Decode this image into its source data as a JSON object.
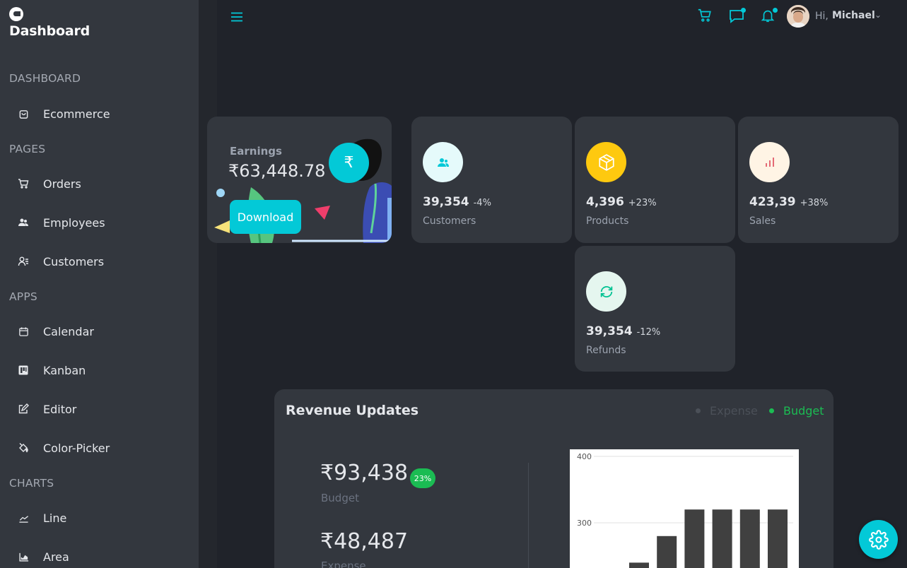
{
  "brand": {
    "title": "Dashboard"
  },
  "sidebar": {
    "sections": [
      {
        "title": "DASHBOARD",
        "items": [
          {
            "label": "Ecommerce",
            "icon": "shopping-bag-icon"
          }
        ]
      },
      {
        "title": "PAGES",
        "items": [
          {
            "label": "Orders",
            "icon": "cart-icon"
          },
          {
            "label": "Employees",
            "icon": "employees-icon"
          },
          {
            "label": "Customers",
            "icon": "customers-icon"
          }
        ]
      },
      {
        "title": "APPS",
        "items": [
          {
            "label": "Calendar",
            "icon": "calendar-icon"
          },
          {
            "label": "Kanban",
            "icon": "kanban-icon"
          },
          {
            "label": "Editor",
            "icon": "edit-icon"
          },
          {
            "label": "Color-Picker",
            "icon": "paint-bucket-icon"
          }
        ]
      },
      {
        "title": "CHARTS",
        "items": [
          {
            "label": "Line",
            "icon": "line-chart-icon"
          },
          {
            "label": "Area",
            "icon": "area-chart-icon"
          }
        ]
      }
    ]
  },
  "topbar": {
    "greeting": "Hi,",
    "user_name": "Michael",
    "chevron": "⌄"
  },
  "earnings": {
    "label": "Earnings",
    "value": "₹63,448.78",
    "currency_symbol": "₹",
    "download_label": "Download"
  },
  "stats": [
    {
      "value": "39,354",
      "percent": "-4%",
      "label": "Customers",
      "icon": "customers-icon",
      "icon_color": "#03c9d7",
      "icon_bg": "#e5fafb"
    },
    {
      "value": "4,396",
      "percent": "+23%",
      "label": "Products",
      "icon": "box-icon",
      "icon_color": "#ffffff",
      "icon_bg": "#fec90f"
    },
    {
      "value": "423,39",
      "percent": "+38%",
      "label": "Sales",
      "icon": "bar-chart-icon",
      "icon_color": "#e46a76",
      "icon_bg": "#fff4e5"
    },
    {
      "value": "39,354",
      "percent": "-12%",
      "label": "Refunds",
      "icon": "refresh-icon",
      "icon_color": "#00c292",
      "icon_bg": "#e5f6ef"
    }
  ],
  "revenue": {
    "title": "Revenue Updates",
    "legend": [
      {
        "label": "Expense",
        "color": "#4b5058"
      },
      {
        "label": "Budget",
        "color": "#1bbc53"
      }
    ],
    "budget_value": "₹93,438",
    "budget_badge": "23%",
    "budget_label": "Budget",
    "expense_value": "₹48,487",
    "expense_label": "Expense"
  },
  "chart_data": {
    "type": "bar",
    "y_ticks": [
      "400",
      "300"
    ],
    "ylim": [
      0,
      400
    ],
    "values": [
      240,
      280,
      320,
      320,
      320,
      320
    ],
    "bar_color": "#404040",
    "grid": true
  }
}
